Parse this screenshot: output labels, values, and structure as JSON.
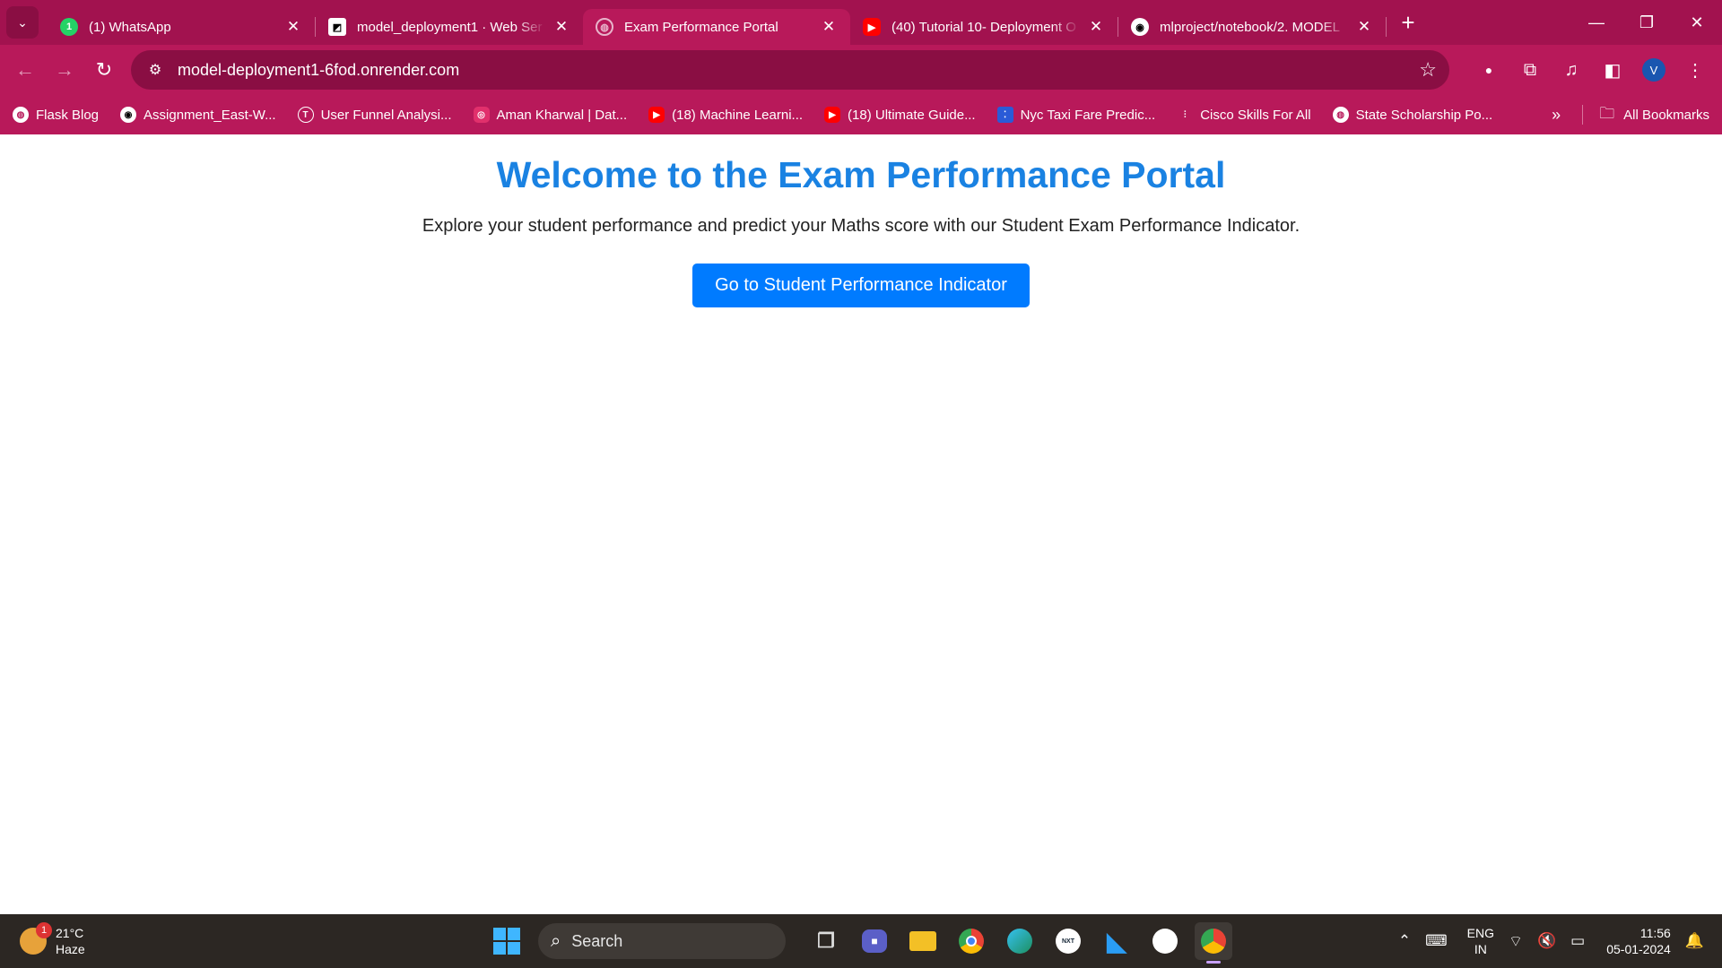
{
  "tabs": [
    {
      "title": "(1) WhatsApp",
      "icon": "whatsapp-icon",
      "active": false
    },
    {
      "title": "model_deployment1 · Web Ser",
      "icon": "render-icon",
      "active": false
    },
    {
      "title": "Exam Performance Portal",
      "icon": "globe-icon",
      "active": true
    },
    {
      "title": "(40) Tutorial 10- Deployment O",
      "icon": "youtube-icon",
      "active": false
    },
    {
      "title": "mlproject/notebook/2. MODEL",
      "icon": "github-icon",
      "active": false
    }
  ],
  "address_bar": {
    "url": "model-deployment1-6fod.onrender.com"
  },
  "profile": {
    "initial": "V"
  },
  "bookmarks": [
    {
      "label": "Flask Blog",
      "icon": "globe-icon"
    },
    {
      "label": "Assignment_East-W...",
      "icon": "github-icon"
    },
    {
      "label": "User Funnel Analysi...",
      "icon": "thecleverprogrammer-icon"
    },
    {
      "label": "Aman Kharwal | Dat...",
      "icon": "instagram-icon"
    },
    {
      "label": "(18) Machine Learni...",
      "icon": "youtube-icon"
    },
    {
      "label": "(18) Ultimate Guide...",
      "icon": "youtube-icon"
    },
    {
      "label": "Nyc Taxi Fare Predic...",
      "icon": "colab-icon"
    },
    {
      "label": "Cisco Skills For All",
      "icon": "cisco-icon"
    },
    {
      "label": "State Scholarship Po...",
      "icon": "globe-icon"
    }
  ],
  "all_bookmarks_label": "All Bookmarks",
  "page": {
    "heading": "Welcome to the Exam Performance Portal",
    "description": "Explore your student performance and predict your Maths score with our Student Exam Performance Indicator.",
    "cta_label": "Go to Student Performance Indicator"
  },
  "taskbar": {
    "weather": {
      "temp": "21°C",
      "condition": "Haze",
      "badge": "1"
    },
    "search_placeholder": "Search",
    "apps": [
      "task-view-icon",
      "teams-icon",
      "file-explorer-icon",
      "chrome-icon",
      "edge-icon",
      "nxtwave-icon",
      "vscode-icon",
      "github-desktop-icon",
      "chrome-profile-icon"
    ],
    "language": {
      "line1": "ENG",
      "line2": "IN"
    },
    "clock": {
      "time": "11:56",
      "date": "05-01-2024"
    }
  },
  "colors": {
    "frame": "#a2124f",
    "toolbar": "#b8195a",
    "heading": "#1a82e2",
    "button": "#007bff",
    "taskbar": "#2c2723"
  }
}
